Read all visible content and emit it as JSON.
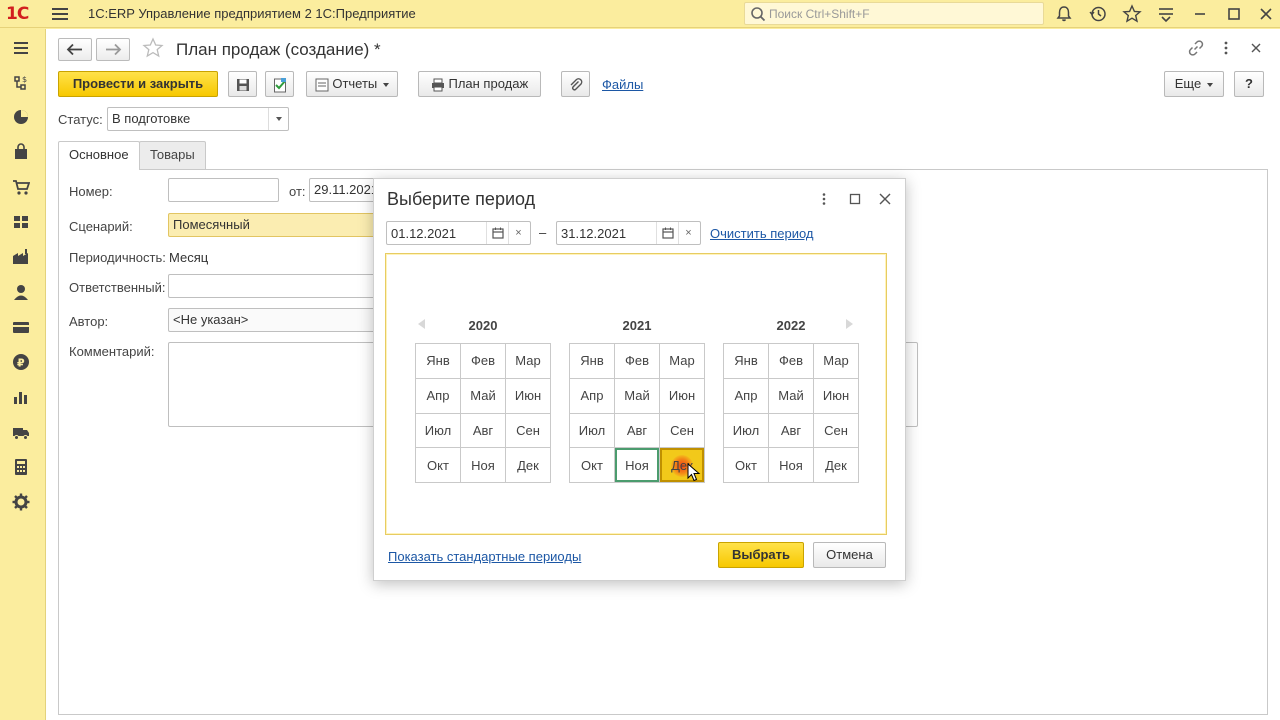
{
  "app": {
    "logo": "1С",
    "title": "1С:ERP Управление предприятием 2 1С:Предприятие",
    "search_placeholder": "Поиск Ctrl+Shift+F"
  },
  "sidebar": {
    "icons": [
      "menu-icon",
      "functions-icon",
      "chart-pie-icon",
      "bag-icon",
      "cart-icon",
      "warehouse-icon",
      "factory-icon",
      "person-icon",
      "card-icon",
      "ruble-icon",
      "bar-chart-icon",
      "truck-icon",
      "calculator-icon",
      "gear-icon"
    ]
  },
  "document": {
    "title": "План продаж (создание) *",
    "toolbar": {
      "post_close": "Провести и закрыть",
      "reports": "Отчеты",
      "sales_plan": "План продаж",
      "files": "Файлы",
      "more": "Еще",
      "help": "?"
    },
    "status_label": "Статус:",
    "status_value": "В подготовке",
    "tabs": [
      "Основное",
      "Товары"
    ],
    "fields": {
      "number_label": "Номер:",
      "number_value": "",
      "date_label": "от:",
      "date_value": "29.11.2021",
      "scenario_label": "Сценарий:",
      "scenario_value": "Помесячный",
      "periodicity_label": "Периодичность:",
      "periodicity_value": "Месяц",
      "responsible_label": "Ответственный:",
      "responsible_value": "",
      "author_label": "Автор:",
      "author_value": "<Не указан>",
      "comment_label": "Комментарий:",
      "comment_value": ""
    }
  },
  "dialog": {
    "title": "Выберите период",
    "date_from": "01.12.2021",
    "date_to": "31.12.2021",
    "dash": "–",
    "clear_link": "Очистить период",
    "clear_symbol": "×",
    "years": [
      "2020",
      "2021",
      "2022"
    ],
    "months": [
      "Янв",
      "Фев",
      "Мар",
      "Апр",
      "Май",
      "Июн",
      "Июл",
      "Авг",
      "Сен",
      "Окт",
      "Ноя",
      "Дек"
    ],
    "selection": {
      "start": "Ноя 2021",
      "end": "Дек 2021"
    },
    "standard_link": "Показать стандартные периоды",
    "ok": "Выбрать",
    "cancel": "Отмена"
  }
}
